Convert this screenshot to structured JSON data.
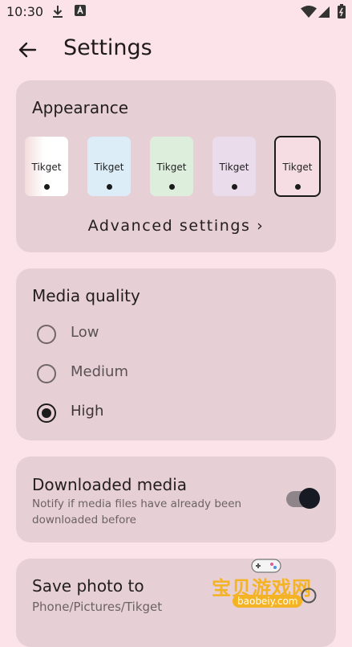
{
  "status_bar": {
    "time": "10:30"
  },
  "header": {
    "title": "Settings"
  },
  "appearance": {
    "title": "Appearance",
    "themes": [
      {
        "label": "Tikget",
        "color": "#fdf3f5",
        "selected": false
      },
      {
        "label": "Tikget",
        "color": "#dcedf7",
        "selected": false
      },
      {
        "label": "Tikget",
        "color": "#ddeedd",
        "selected": false
      },
      {
        "label": "Tikget",
        "color": "#eadcea",
        "selected": false
      },
      {
        "label": "Tikget",
        "color": "#f5dde3",
        "selected": true
      }
    ],
    "advanced_label": "Advanced settings ›"
  },
  "media_quality": {
    "title": "Media quality",
    "options": [
      {
        "label": "Low",
        "selected": false
      },
      {
        "label": "Medium",
        "selected": false
      },
      {
        "label": "High",
        "selected": true
      }
    ]
  },
  "downloaded_media": {
    "title": "Downloaded media",
    "description": "Notify if media files have already been downloaded before",
    "enabled": true
  },
  "save_photo": {
    "title": "Save photo to",
    "path": "Phone/Pictures/Tikget"
  },
  "watermark": {
    "text": "宝贝游戏网",
    "url": "baobeiy.com"
  }
}
